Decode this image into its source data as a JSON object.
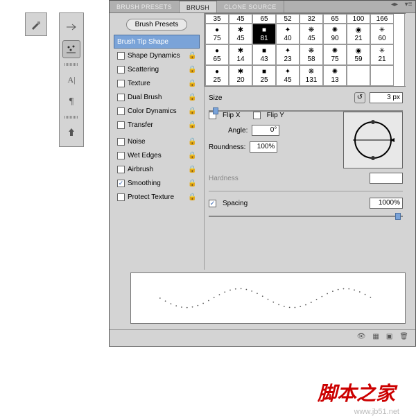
{
  "tabs": [
    "BRUSH PRESETS",
    "BRUSH",
    "CLONE SOURCE"
  ],
  "active_tab": 1,
  "presets_button": "Brush Presets",
  "options": [
    {
      "label": "Brush Tip Shape",
      "selected": true,
      "checkbox": false,
      "lock": false
    },
    {
      "label": "Shape Dynamics",
      "checked": false,
      "lock": true
    },
    {
      "label": "Scattering",
      "checked": false,
      "lock": true
    },
    {
      "label": "Texture",
      "checked": false,
      "lock": true
    },
    {
      "label": "Dual Brush",
      "checked": false,
      "lock": true
    },
    {
      "label": "Color Dynamics",
      "checked": false,
      "lock": true
    },
    {
      "label": "Transfer",
      "checked": false,
      "lock": true
    },
    {
      "gap": true
    },
    {
      "label": "Noise",
      "checked": false,
      "lock": true
    },
    {
      "label": "Wet Edges",
      "checked": false,
      "lock": true
    },
    {
      "label": "Airbrush",
      "checked": false,
      "lock": true
    },
    {
      "label": "Smoothing",
      "checked": true,
      "lock": true
    },
    {
      "label": "Protect Texture",
      "checked": false,
      "lock": true
    }
  ],
  "brush_row0": [
    "35",
    "45",
    "65",
    "52",
    "32",
    "65",
    "100",
    "166"
  ],
  "brushes": [
    "75",
    "45",
    "81",
    "40",
    "45",
    "90",
    "21",
    "60",
    "65",
    "14",
    "43",
    "23",
    "58",
    "75",
    "59",
    "21",
    "25",
    "20",
    "25",
    "45",
    "131",
    "13"
  ],
  "selected_brush": 2,
  "size_label": "Size",
  "size_value": "3 px",
  "flipx": "Flip X",
  "flipy": "Flip Y",
  "angle_label": "Angle:",
  "angle_value": "0°",
  "roundness_label": "Roundness:",
  "roundness_value": "100%",
  "hardness_label": "Hardness",
  "hardness_value": "",
  "spacing_label": "Spacing",
  "spacing_value": "1000%",
  "spacing_checked": true,
  "toolbox_icon": "brush-tool",
  "optbar": [
    "flow",
    "scatter",
    "type",
    "para",
    "reset"
  ],
  "watermark": "脚本之家",
  "sub_watermark": "www.jb51.net"
}
